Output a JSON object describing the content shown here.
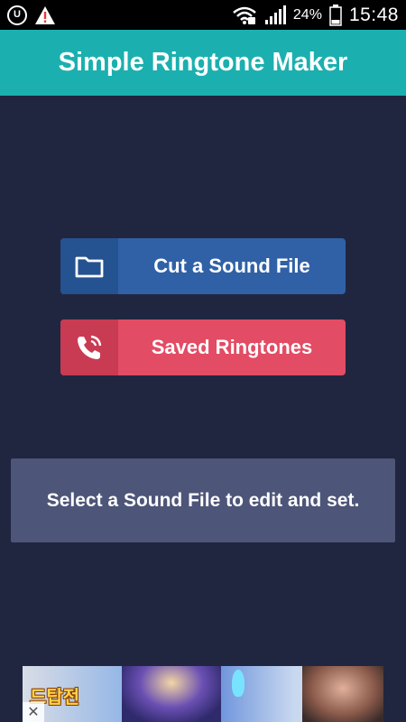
{
  "status_bar": {
    "u_icon_text": "U",
    "battery_percent": "24%",
    "time": "15:48",
    "icons": [
      "u-icon",
      "warning-icon",
      "wifi-icon",
      "signal-icon",
      "battery-icon"
    ]
  },
  "header": {
    "title": "Simple Ringtone Maker"
  },
  "main": {
    "buttons": [
      {
        "label": "Cut a Sound File",
        "icon": "folder-icon",
        "color": "#3061a6"
      },
      {
        "label": "Saved Ringtones",
        "icon": "phone-ring-icon",
        "color": "#e24c64"
      }
    ],
    "info_text": "Select a Sound File to edit and set."
  },
  "ad": {
    "logo_text": "드탑전",
    "close_symbol": "✕"
  },
  "colors": {
    "background": "#212640",
    "title_bar": "#1bb0af",
    "info_box": "#4d5578"
  }
}
